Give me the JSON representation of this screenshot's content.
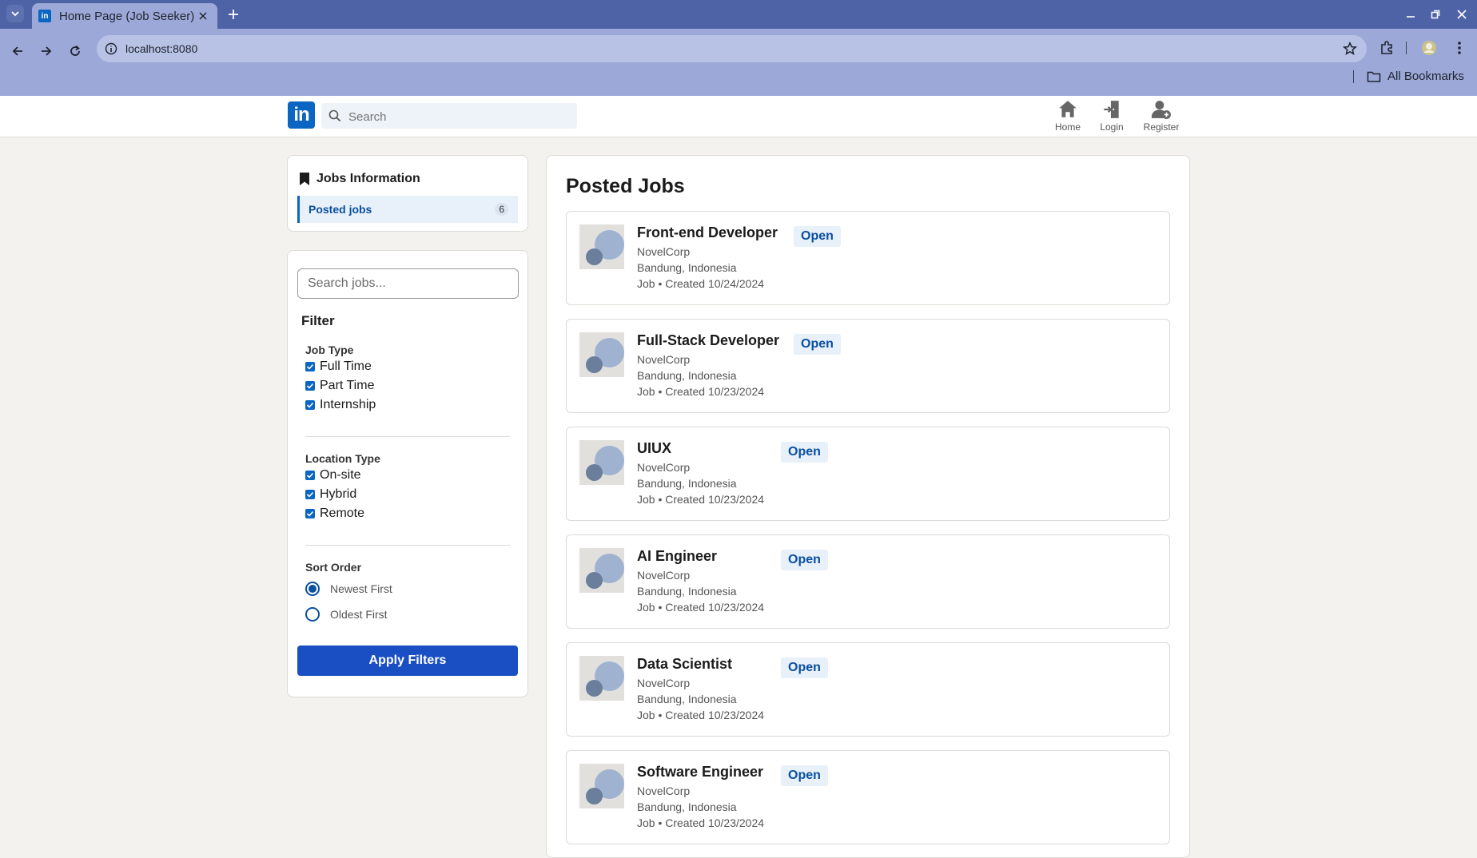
{
  "browser": {
    "tab_title": "Home Page (Job Seeker)",
    "tab_favicon": "in",
    "url": "localhost:8080",
    "bookmarks_label": "All Bookmarks"
  },
  "header": {
    "logo": "in",
    "search_placeholder": "Search",
    "nav": [
      {
        "label": "Home",
        "icon": "home-icon"
      },
      {
        "label": "Login",
        "icon": "login-icon"
      },
      {
        "label": "Register",
        "icon": "register-icon"
      }
    ]
  },
  "sidebar": {
    "info_title": "Jobs Information",
    "posted_label": "Posted jobs",
    "posted_count": "6",
    "search_placeholder": "Search jobs...",
    "filter_title": "Filter",
    "job_type": {
      "title": "Job Type",
      "options": [
        "Full Time",
        "Part Time",
        "Internship"
      ]
    },
    "location_type": {
      "title": "Location Type",
      "options": [
        "On-site",
        "Hybrid",
        "Remote"
      ]
    },
    "sort": {
      "title": "Sort Order",
      "options": [
        "Newest First",
        "Oldest First"
      ],
      "selected": "Newest First"
    },
    "apply_label": "Apply Filters"
  },
  "main": {
    "title": "Posted Jobs",
    "jobs": [
      {
        "title": "Front-end Developer",
        "status": "Open",
        "company": "NovelCorp",
        "location": "Bandung, Indonesia",
        "meta": "Job • Created 10/24/2024"
      },
      {
        "title": "Full-Stack Developer",
        "status": "Open",
        "company": "NovelCorp",
        "location": "Bandung, Indonesia",
        "meta": "Job • Created 10/23/2024"
      },
      {
        "title": "UIUX",
        "status": "Open",
        "company": "NovelCorp",
        "location": "Bandung, Indonesia",
        "meta": "Job • Created 10/23/2024"
      },
      {
        "title": "AI Engineer",
        "status": "Open",
        "company": "NovelCorp",
        "location": "Bandung, Indonesia",
        "meta": "Job • Created 10/23/2024"
      },
      {
        "title": "Data Scientist",
        "status": "Open",
        "company": "NovelCorp",
        "location": "Bandung, Indonesia",
        "meta": "Job • Created 10/23/2024"
      },
      {
        "title": "Software Engineer",
        "status": "Open",
        "company": "NovelCorp",
        "location": "Bandung, Indonesia",
        "meta": "Job • Created 10/23/2024"
      }
    ]
  },
  "colors": {
    "brand": "#0a66c2",
    "accent_button": "#1a4fc4",
    "page_bg": "#f4f2ee"
  }
}
